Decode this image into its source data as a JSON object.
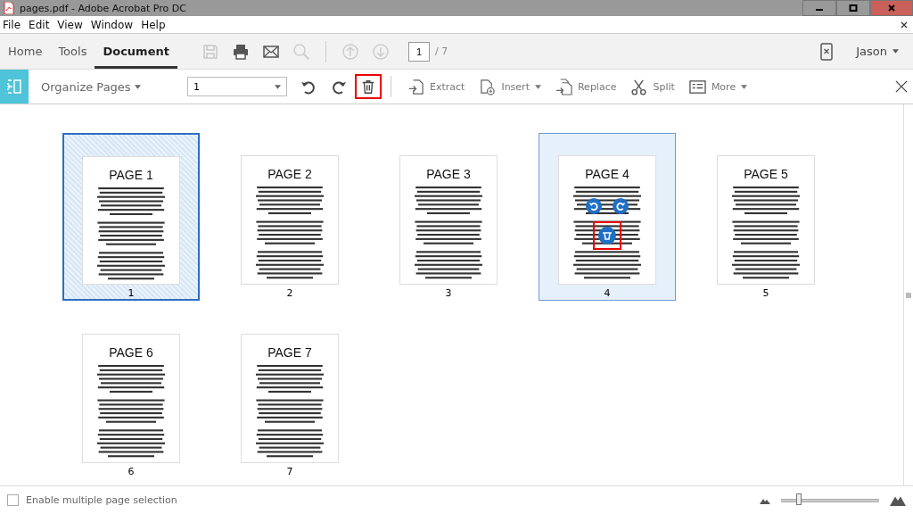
{
  "window": {
    "title": "pages.pdf - Adobe Acrobat Pro DC"
  },
  "menu": [
    "File",
    "Edit",
    "View",
    "Window",
    "Help"
  ],
  "tabs": [
    {
      "label": "Home",
      "selected": false
    },
    {
      "label": "Tools",
      "selected": false
    },
    {
      "label": "Document",
      "selected": true
    }
  ],
  "page_nav": {
    "current": "1",
    "total": "/ 7"
  },
  "user": {
    "name": "Jason"
  },
  "toolbar": {
    "title": "Organize Pages",
    "page_range": "1",
    "actions": [
      {
        "label": "Extract"
      },
      {
        "label": "Insert",
        "dropdown": true
      },
      {
        "label": "Replace"
      },
      {
        "label": "Split"
      },
      {
        "label": "More",
        "dropdown": true
      }
    ]
  },
  "pages": [
    {
      "title": "PAGE 1",
      "number": "1",
      "selected": true,
      "hovered": false
    },
    {
      "title": "PAGE 2",
      "number": "2",
      "selected": false,
      "hovered": false
    },
    {
      "title": "PAGE 3",
      "number": "3",
      "selected": false,
      "hovered": false
    },
    {
      "title": "PAGE 4",
      "number": "4",
      "selected": false,
      "hovered": true
    },
    {
      "title": "PAGE 5",
      "number": "5",
      "selected": false,
      "hovered": false
    },
    {
      "title": "PAGE 6",
      "number": "6",
      "selected": false,
      "hovered": false
    },
    {
      "title": "PAGE 7",
      "number": "7",
      "selected": false,
      "hovered": false
    }
  ],
  "footer": {
    "multi_select": {
      "label": "Enable multiple page selection",
      "checked": false
    },
    "zoom": {
      "level": 0.18
    }
  }
}
